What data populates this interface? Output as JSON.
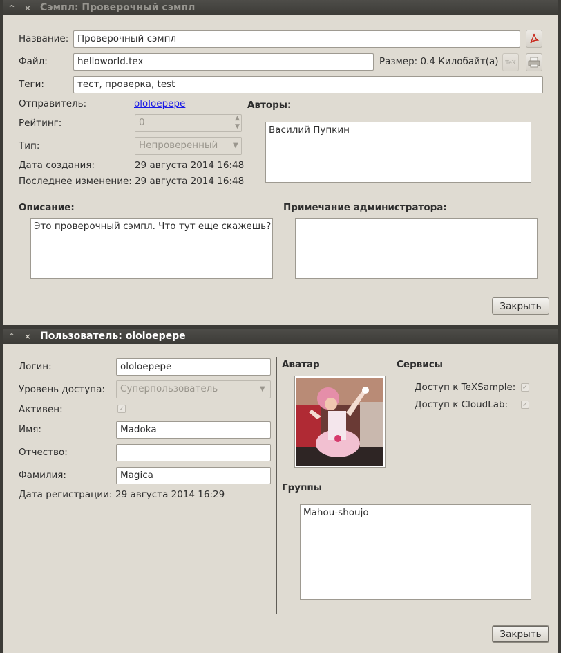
{
  "sample_window": {
    "title": "Сэмпл: Проверочный сэмпл",
    "labels": {
      "name": "Название:",
      "file": "Файл:",
      "tags": "Теги:",
      "sender": "Отправитель:",
      "rating": "Рейтинг:",
      "type": "Тип:",
      "created": "Дата создания:",
      "modified": "Последнее изменение:",
      "authors": "Авторы:",
      "description": "Описание:",
      "admin_note": "Примечание администратора:"
    },
    "name_value": "Проверочный сэмпл",
    "file_value": "helloworld.tex",
    "size_text": "Размер: 0.4 Килобайт(а)",
    "tags_value": "тест, проверка, test",
    "sender_link": "ololoepepe",
    "rating_value": "0",
    "type_value": "Непроверенный",
    "created_value": "29 августа 2014 16:48",
    "modified_value": "29 августа 2014 16:48",
    "authors_list": [
      "Василий Пупкин"
    ],
    "description_text": "Это проверочный сэмпл. Что тут еще скажешь?",
    "admin_note_text": "",
    "close_label": "Закрыть",
    "tex_icon_text": "TeX"
  },
  "user_window": {
    "title": "Пользователь: ololoepepe",
    "labels": {
      "login": "Логин:",
      "access_level": "Уровень доступа:",
      "active": "Активен:",
      "first_name": "Имя:",
      "patronymic": "Отчество:",
      "last_name": "Фамилия:",
      "reg_date": "Дата регистрации:",
      "avatar": "Аватар",
      "services": "Сервисы",
      "groups": "Группы",
      "texsample_access": "Доступ к TeXSample:",
      "cloudlab_access": "Доступ к CloudLab:"
    },
    "login_value": "ololoepepe",
    "access_level_value": "Суперпользователь",
    "first_name_value": "Madoka",
    "patronymic_value": "",
    "last_name_value": "Magica",
    "reg_date_value": "29 августа 2014 16:29",
    "active_checked": true,
    "texsample_checked": true,
    "cloudlab_checked": true,
    "groups_list": [
      "Mahou-shoujo"
    ],
    "close_label": "Закрыть"
  },
  "window_buttons": {
    "minimize": "^",
    "close": "×"
  },
  "colors": {
    "window_bg": "#dfdbd2",
    "titlebar_bg": "#3c3b37",
    "inactive_title": "#97958f",
    "active_title": "#ffffff",
    "link": "#1a1ae6",
    "pdf_icon_red": "#c8261a"
  }
}
